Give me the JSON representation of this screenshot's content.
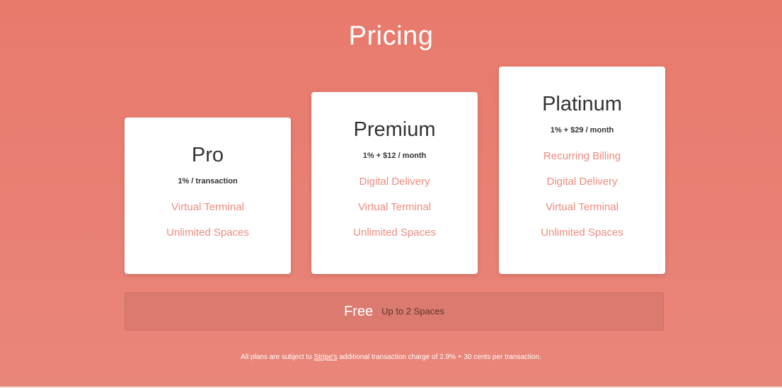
{
  "header": {
    "title": "Pricing"
  },
  "plans": [
    {
      "name": "Pro",
      "price": "1% / transaction",
      "features": [
        "Virtual Terminal",
        "Unlimited Spaces"
      ]
    },
    {
      "name": "Premium",
      "price": "1% + $12 / month",
      "features": [
        "Digital Delivery",
        "Virtual Terminal",
        "Unlimited Spaces"
      ]
    },
    {
      "name": "Platinum",
      "price": "1% + $29 / month",
      "features": [
        "Recurring Billing",
        "Digital Delivery",
        "Virtual Terminal",
        "Unlimited Spaces"
      ]
    }
  ],
  "free_plan": {
    "label": "Free",
    "detail": "Up to 2 Spaces"
  },
  "footnote": {
    "before": "All plans are subject to ",
    "link": "Stripe's",
    "after": " additional transaction charge of 2.9% + 30 cents per transaction."
  },
  "colors": {
    "background": "#e87a6c",
    "card": "#ffffff",
    "feature_text": "#ef8a7e",
    "free_bar": "#db7a6f"
  }
}
